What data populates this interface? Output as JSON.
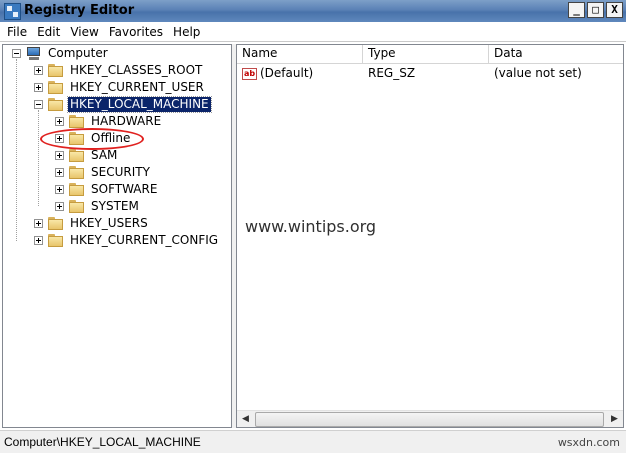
{
  "window": {
    "title": "Registry Editor"
  },
  "controls": {
    "minimize": "_",
    "maximize": "□",
    "close": "X"
  },
  "menu": [
    "File",
    "Edit",
    "View",
    "Favorites",
    "Help"
  ],
  "tree": {
    "root": "Computer",
    "hives": [
      "HKEY_CLASSES_ROOT",
      "HKEY_CURRENT_USER",
      "HKEY_LOCAL_MACHINE",
      "HKEY_USERS",
      "HKEY_CURRENT_CONFIG"
    ],
    "hklm_children": [
      "HARDWARE",
      "Offline",
      "SAM",
      "SECURITY",
      "SOFTWARE",
      "SYSTEM"
    ],
    "selected": "HKEY_LOCAL_MACHINE",
    "highlighted": "Offline"
  },
  "list": {
    "columns": [
      "Name",
      "Type",
      "Data"
    ],
    "rows": [
      {
        "icon": "ab",
        "name": "(Default)",
        "type": "REG_SZ",
        "data": "(value not set)"
      }
    ]
  },
  "watermark": "www.wintips.org",
  "status": {
    "path": "Computer\\HKEY_LOCAL_MACHINE"
  },
  "site_mark": "wsxdn.com",
  "colors": {
    "selection": "#0a246a",
    "highlight_ring": "#e0211f",
    "folder": "#f0d586"
  }
}
